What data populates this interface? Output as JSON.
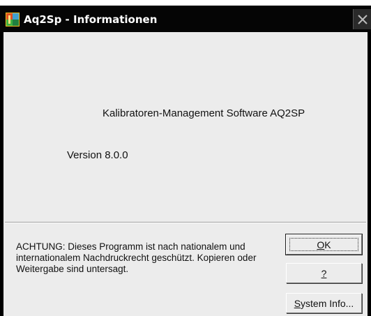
{
  "window": {
    "title": "Aq2Sp - Informationen",
    "icons": {
      "app": "aq2sp-app-icon",
      "close": "close-icon"
    }
  },
  "content": {
    "product_name": "Kalibratoren-Management Software AQ2SP",
    "version": "Version 8.0.0",
    "warning": "ACHTUNG: Dieses Programm ist nach nationalem und internationalem Nachdruckrecht geschützt. Kopieren oder Weitergabe sind untersagt."
  },
  "buttons": {
    "ok": {
      "mnemonic": "O",
      "rest": "K"
    },
    "help": {
      "label": "?"
    },
    "system_info": {
      "mnemonic": "S",
      "rest": "ystem Info..."
    }
  }
}
